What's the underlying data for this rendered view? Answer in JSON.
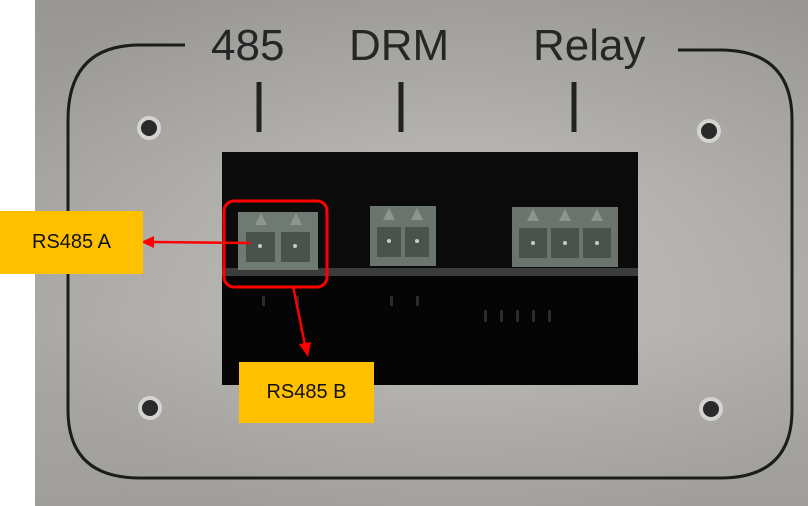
{
  "port_labels": {
    "rs485": "485",
    "drm": "DRM",
    "relay": "Relay"
  },
  "callouts": {
    "rs485_a": "RS485 A",
    "rs485_b": "RS485 B"
  },
  "colors": {
    "panel": "#b4b2ae",
    "port_window": "#0b0b0b",
    "connector": "#6f7a72",
    "highlight": "#ff0000",
    "callout_bg": "#ffc000"
  }
}
